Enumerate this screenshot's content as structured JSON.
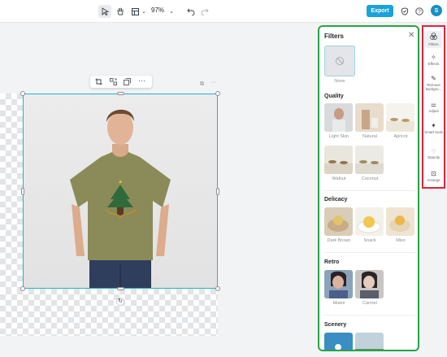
{
  "toolbar": {
    "zoom": "97%",
    "export_label": "Export",
    "avatar_letter": "S",
    "icons": [
      "select-pointer-icon",
      "hand-icon",
      "layout-icon",
      "chevron-down-icon",
      "undo-icon",
      "redo-icon",
      "shield-icon",
      "help-icon"
    ]
  },
  "canvas": {
    "float_toolbar_icons": [
      "crop-icon",
      "flip-icon",
      "duplicate-icon",
      "more-icon"
    ]
  },
  "filters": {
    "title": "Filters",
    "none_label": "None",
    "sections": [
      {
        "title": "Quality",
        "items": [
          "Light Skin",
          "Natural",
          "Apricot",
          "Walnut",
          "Coconut"
        ]
      },
      {
        "title": "Delicacy",
        "items": [
          "Dark Brown",
          "Snack",
          "Miso"
        ]
      },
      {
        "title": "Retro",
        "items": [
          "Miami",
          "Carmel"
        ]
      },
      {
        "title": "Scenery",
        "items": []
      }
    ]
  },
  "rail": {
    "items": [
      {
        "label": "Filters",
        "icon": "filters-icon"
      },
      {
        "label": "Effects",
        "icon": "effects-icon"
      },
      {
        "label": "Remove backgro...",
        "icon": "remove-bg-icon"
      },
      {
        "label": "Adjust",
        "icon": "adjust-icon"
      },
      {
        "label": "Smart tools",
        "icon": "smart-tools-icon"
      },
      {
        "label": "Opacity",
        "icon": "opacity-icon"
      },
      {
        "label": "Arrange",
        "icon": "arrange-icon"
      }
    ]
  },
  "colors": {
    "accent": "#27b3c6",
    "export": "#1aa3d8",
    "panel_outline": "#25a447",
    "rail_outline": "#e0233b"
  }
}
